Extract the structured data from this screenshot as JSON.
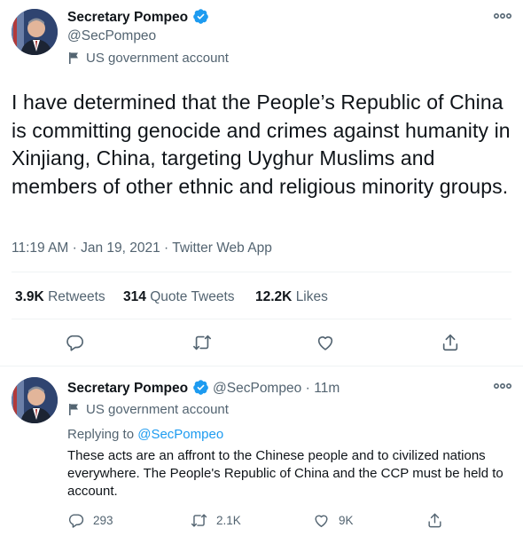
{
  "main_tweet": {
    "author_name": "Secretary Pompeo",
    "author_handle": "@SecPompeo",
    "account_label": "US government account",
    "text": "I have determined that the People’s Republic of China is committing genocide and crimes against humanity in Xinjiang, China, targeting Uyghur Muslims and members of other ethnic and religious minority groups.",
    "timestamp": "11:19 AM · Jan 19, 2021 · Twitter Web App",
    "stats": {
      "retweets_count": "3.9K",
      "retweets_label": "Retweets",
      "quote_count": "314",
      "quote_label": "Quote Tweets",
      "likes_count": "12.2K",
      "likes_label": "Likes"
    }
  },
  "reply_tweet": {
    "author_name": "Secretary Pompeo",
    "author_handle": "@SecPompeo",
    "separator": "·",
    "time_ago": "11m",
    "account_label": "US government account",
    "replying_prefix": "Replying to",
    "replying_to": "@SecPompeo",
    "text": "These acts are an affront to the Chinese people and to civilized nations everywhere. The People's Republic of China and the CCP must be held to account.",
    "counts": {
      "replies": "293",
      "retweets": "2.1K",
      "likes": "9K"
    }
  },
  "colors": {
    "verified_blue": "#1d9bf0",
    "text_primary": "#0f1419",
    "text_secondary": "#536471",
    "divider": "#eff3f4"
  },
  "icons": [
    "verified-badge-icon",
    "more-options-icon",
    "flag-icon",
    "reply-icon",
    "retweet-icon",
    "like-icon",
    "share-icon"
  ]
}
